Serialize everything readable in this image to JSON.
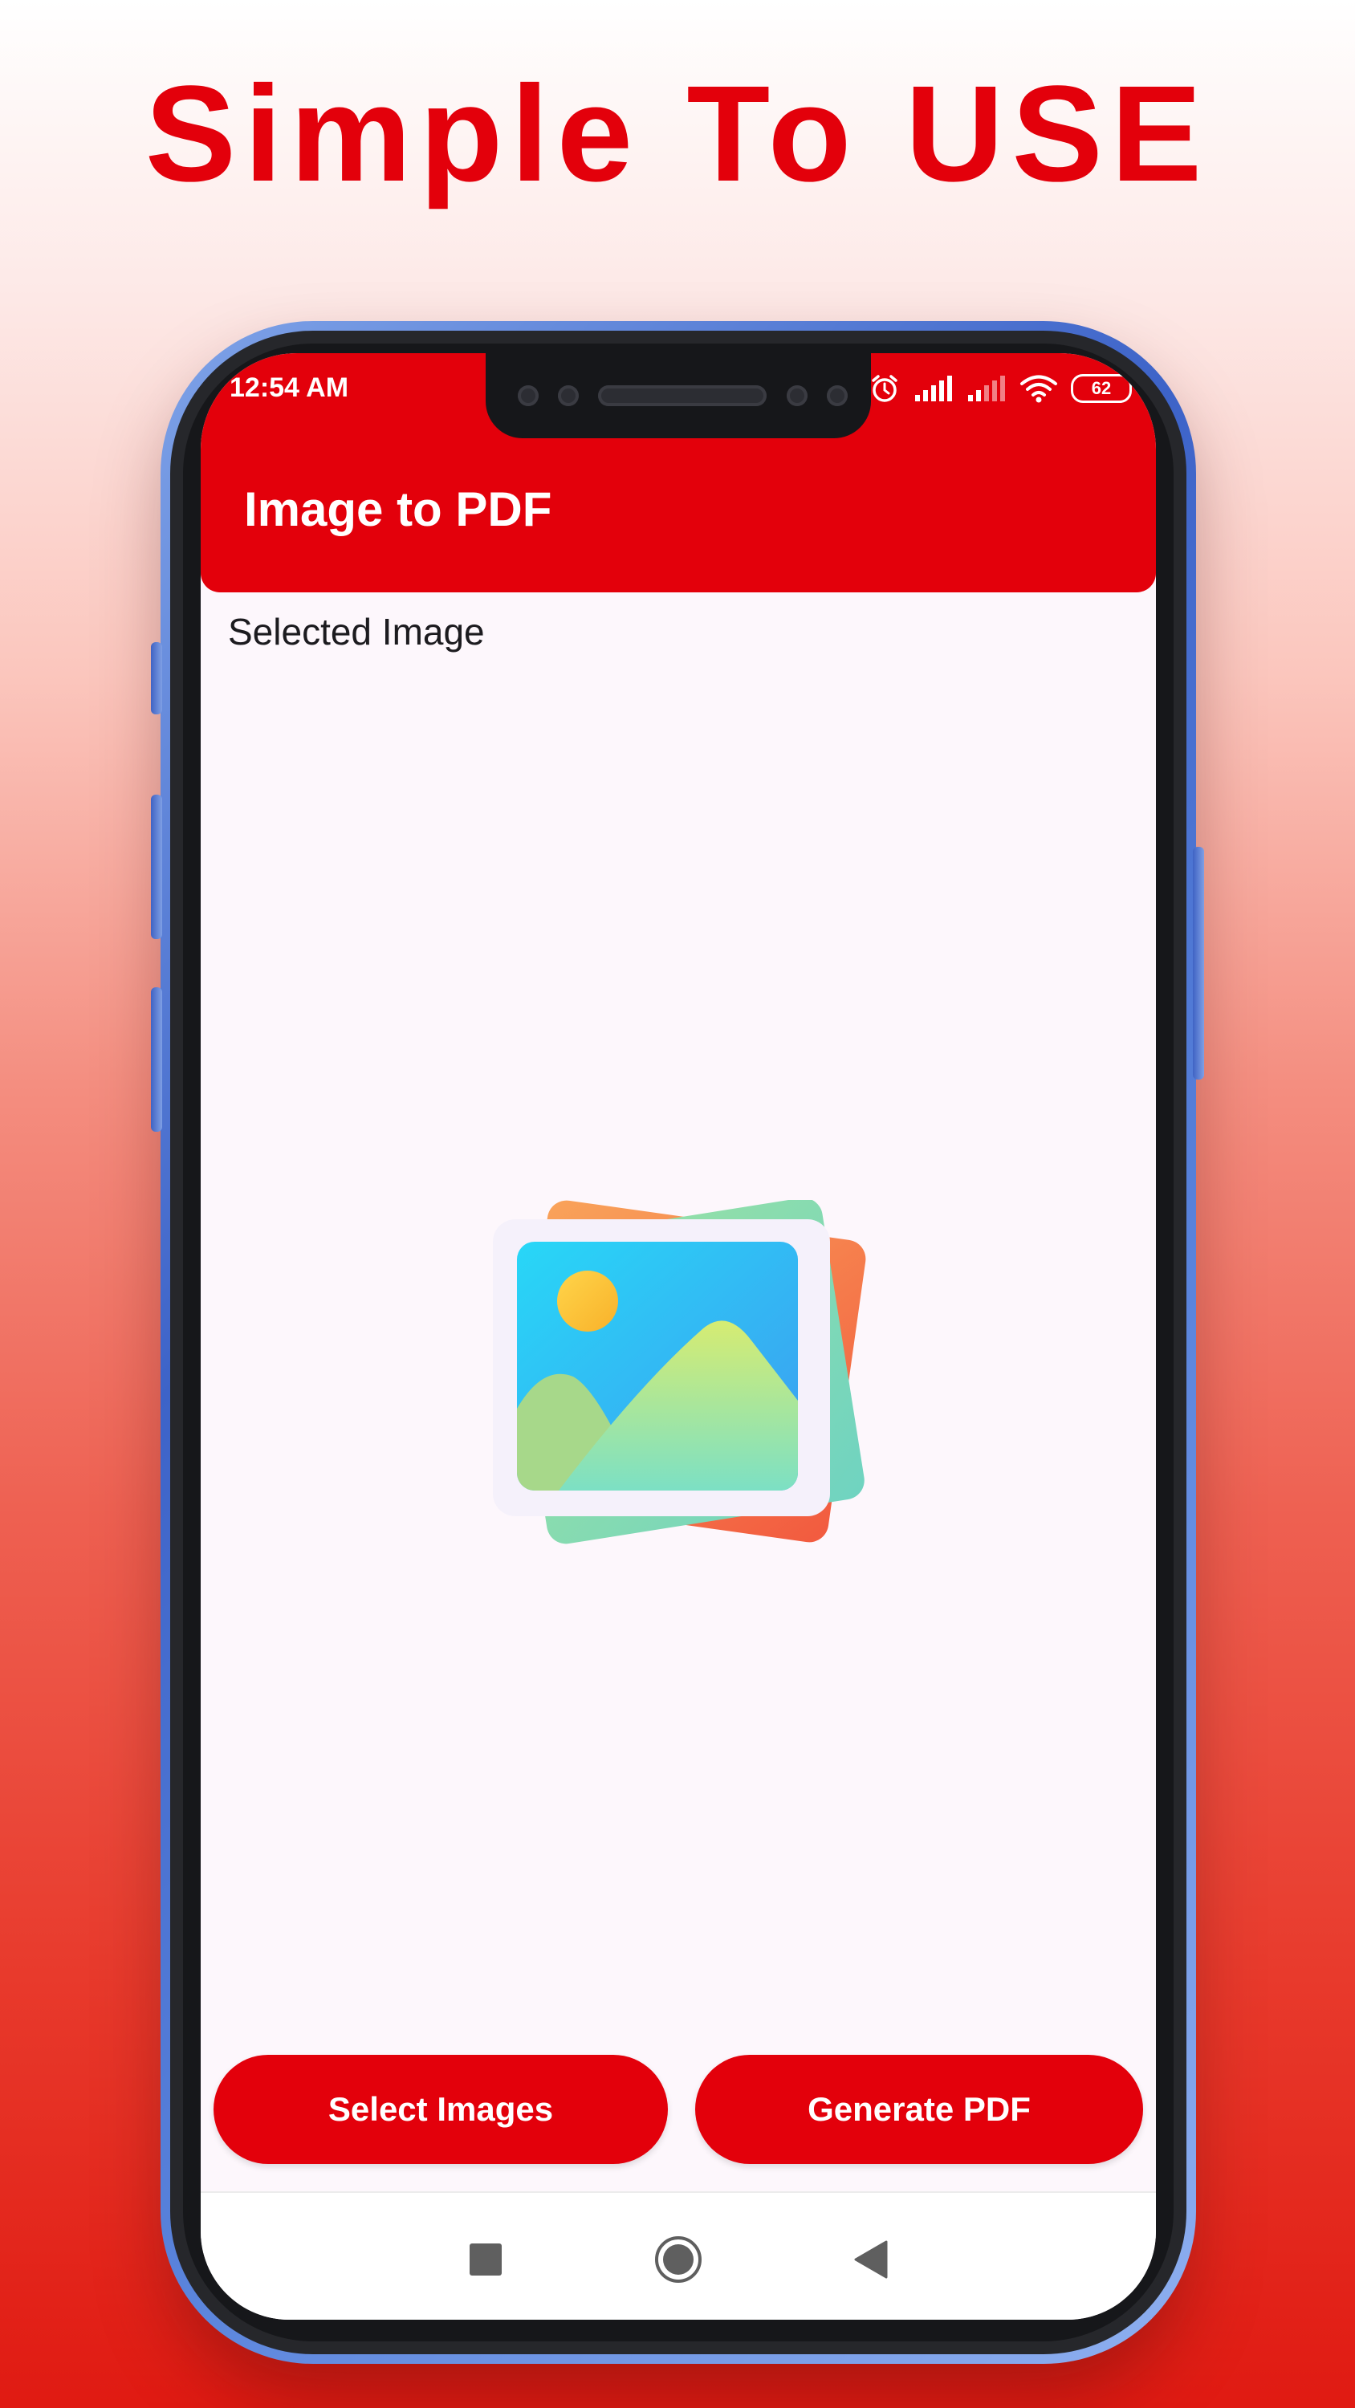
{
  "promo": {
    "headline": "Simple To USE"
  },
  "status_bar": {
    "time": "12:54 AM",
    "battery": "62",
    "icons": [
      "alarm-icon",
      "signal-icon",
      "signal-weak-icon",
      "wifi-icon",
      "battery-icon"
    ]
  },
  "app_bar": {
    "title": "Image to PDF"
  },
  "content": {
    "section_label": "Selected Image",
    "placeholder_icon": "gallery-placeholder-icon"
  },
  "actions": {
    "select_label": "Select Images",
    "generate_label": "Generate PDF"
  },
  "nav_bar": {
    "items": [
      "recent-apps-icon",
      "home-icon",
      "back-icon"
    ]
  },
  "colors": {
    "brand_red": "#e3000b",
    "screen_bg": "#fdf7fc",
    "frame_blue": "#3d63c8"
  }
}
